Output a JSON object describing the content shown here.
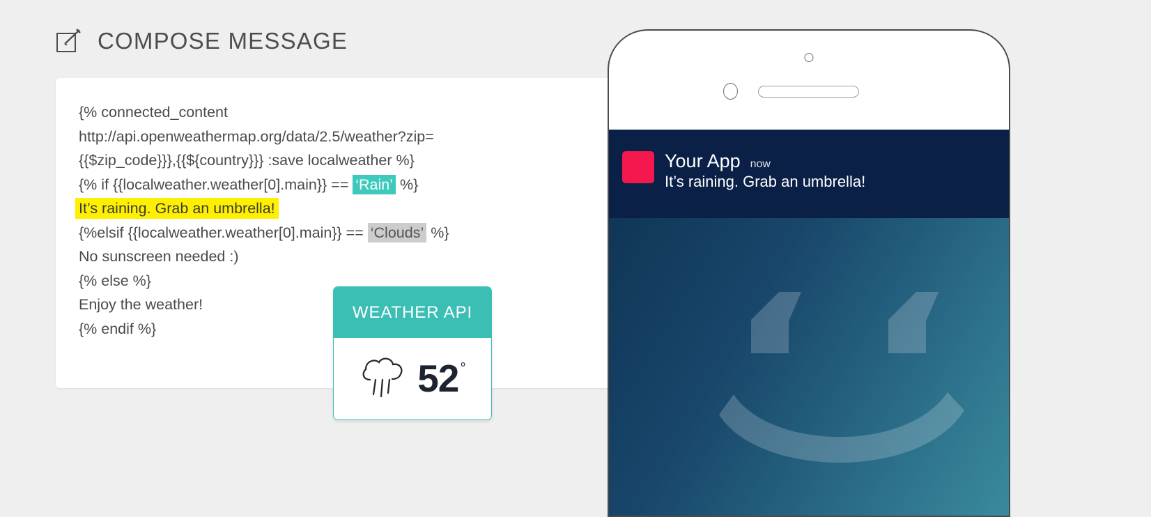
{
  "page": {
    "background_color": "#efefef"
  },
  "header": {
    "icon": "compose-pencil-icon",
    "title": "COMPOSE MESSAGE",
    "title_color": "#4d4d4d"
  },
  "editor": {
    "background_color": "#ffffff",
    "code_lines": [
      {
        "id": "line-1",
        "text": "{% connected_content"
      },
      {
        "id": "line-2",
        "text": "http://api.openweathermap.org/data/2.5/weather?zip="
      },
      {
        "id": "line-3",
        "text": "{{$zip_code}}},{{${country}}} :save localweather %}"
      },
      {
        "id": "line-4",
        "prefix": "{% if {{localweather.weather[0].main}} == ",
        "highlight": "‘Rain’",
        "highlight_style": "teal",
        "suffix": " %}"
      },
      {
        "id": "line-5",
        "text": "It’s raining. Grab an umbrella!",
        "highlight_style": "yellow"
      },
      {
        "id": "line-6",
        "prefix": "{%elsif {{localweather.weather[0].main}} == ",
        "highlight": "‘Clouds’",
        "highlight_style": "gray",
        "suffix": " %}"
      },
      {
        "id": "line-7",
        "text": "No sunscreen needed :)"
      },
      {
        "id": "line-8",
        "text": "{% else %}"
      },
      {
        "id": "line-9",
        "text": "Enjoy the weather!"
      },
      {
        "id": "line-10",
        "text": "{% endif %}"
      }
    ],
    "highlight_colors": {
      "teal": "#3ec9bd",
      "gray": "#cccccc",
      "yellow": "#fff000"
    }
  },
  "weather_card": {
    "header_label": "WEATHER API",
    "header_color": "#3bbfb5",
    "icon": "rain-cloud-icon",
    "temperature": "52",
    "degree_symbol": "°"
  },
  "phone": {
    "sensor_icon": "proximity-sensor-icon",
    "camera_icon": "front-camera-icon",
    "speaker_icon": "earpiece-speaker-icon",
    "notification": {
      "app_icon_color": "#f5184f",
      "app_name": "Your App",
      "time": "now",
      "message": "It’s raining. Grab an umbrella!",
      "background_color": "#0a2047"
    },
    "wallpaper": {
      "type": "smiley-face",
      "gradient_from": "#0f3557",
      "gradient_to": "#3a8ca0",
      "face_color": "rgba(255,255,255,0.22)"
    }
  }
}
